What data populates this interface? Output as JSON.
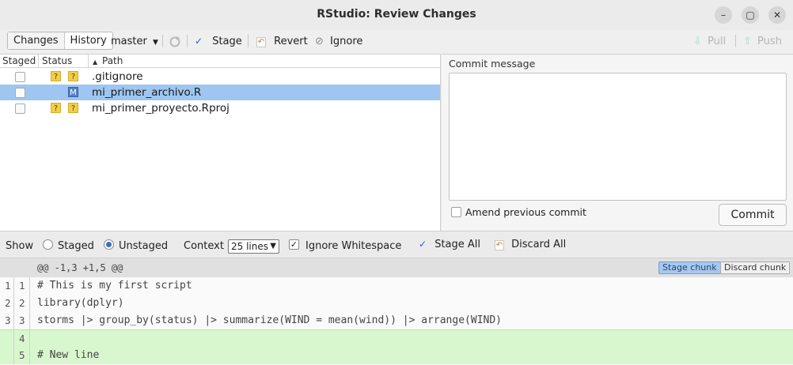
{
  "window": {
    "title": "RStudio: Review Changes",
    "controls": [
      "minimize-icon",
      "maximize-icon",
      "close-icon"
    ]
  },
  "toolbar": {
    "tab_changes": "Changes",
    "tab_history": "History",
    "branch": "master",
    "stage": "Stage",
    "revert": "Revert",
    "ignore": "Ignore",
    "pull": "Pull",
    "push": "Push"
  },
  "files": {
    "columns": {
      "staged": "Staged",
      "status": "Status",
      "path": "Path"
    },
    "rows": [
      {
        "staged": false,
        "status": [
          "?",
          "?"
        ],
        "path": ".gitignore",
        "selected": false
      },
      {
        "staged": false,
        "status": [
          "",
          "M"
        ],
        "path": "mi_primer_archivo.R",
        "selected": true
      },
      {
        "staged": false,
        "status": [
          "?",
          "?"
        ],
        "path": "mi_primer_proyecto.Rproj",
        "selected": false
      }
    ]
  },
  "commit": {
    "label": "Commit message",
    "message": "",
    "amend_label": "Amend previous commit",
    "button": "Commit"
  },
  "diff_toolbar": {
    "show": "Show",
    "staged": "Staged",
    "unstaged": "Unstaged",
    "show_selected": "Unstaged",
    "context": "Context",
    "context_value": "25 lines",
    "ignore_whitespace": "Ignore Whitespace",
    "stage_all": "Stage All",
    "discard_all": "Discard All"
  },
  "diff": {
    "hunk_header": "@@ -1,3 +1,5 @@",
    "stage_chunk": "Stage chunk",
    "discard_chunk": "Discard chunk",
    "lines": [
      {
        "old": "1",
        "new": "1",
        "text": "# This is my first script",
        "type": "context"
      },
      {
        "old": "2",
        "new": "2",
        "text": "library(dplyr)",
        "type": "context"
      },
      {
        "old": "3",
        "new": "3",
        "text": "storms |> group_by(status) |> summarize(WIND = mean(wind)) |> arrange(WIND)",
        "type": "context"
      },
      {
        "old": "",
        "new": "4",
        "text": "",
        "type": "added"
      },
      {
        "old": "",
        "new": "5",
        "text": "# New line",
        "type": "added"
      }
    ]
  },
  "colors": {
    "selected_row": "#9ec6f0",
    "added_line": "#d9f7cf",
    "unknown_badge": "#f1cf48",
    "modified_badge": "#5580c8"
  }
}
